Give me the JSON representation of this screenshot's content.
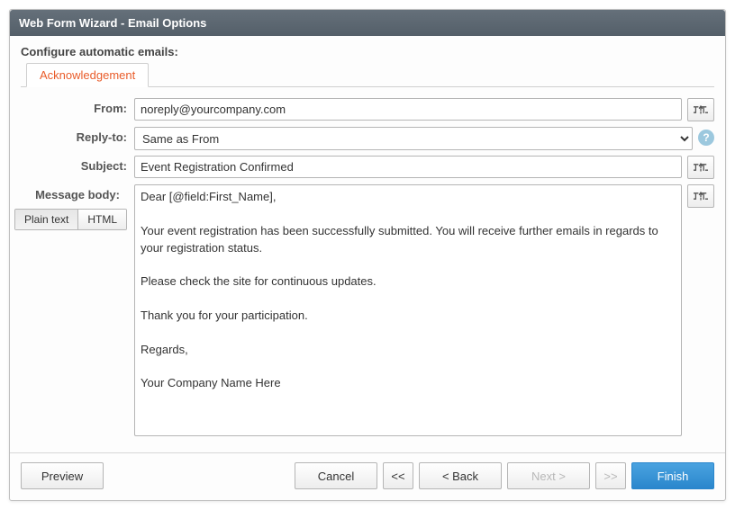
{
  "header": {
    "title": "Web Form Wizard - Email Options"
  },
  "section_title": "Configure automatic emails:",
  "tabs": {
    "acknowledgement": "Acknowledgement"
  },
  "fields": {
    "from_label": "From:",
    "from_value": "noreply@yourcompany.com",
    "reply_to_label": "Reply-to:",
    "reply_to_value": "Same as From",
    "subject_label": "Subject:",
    "subject_value": "Event Registration Confirmed",
    "body_label": "Message body:",
    "body_value": "Dear [@field:First_Name],\n\nYour event registration has been successfully submitted. You will receive further emails in regards to your registration status.\n\nPlease check the site for continuous updates.\n\nThank you for your participation.\n\nRegards,\n\nYour Company Name Here"
  },
  "format_toggle": {
    "plain": "Plain text",
    "html": "HTML",
    "active": "plain"
  },
  "icons": {
    "insert_field": "insert-field-icon",
    "help": "?"
  },
  "footer": {
    "preview": "Preview",
    "cancel": "Cancel",
    "first": "<<",
    "back": "< Back",
    "next": "Next >",
    "last": ">>",
    "finish": "Finish"
  }
}
